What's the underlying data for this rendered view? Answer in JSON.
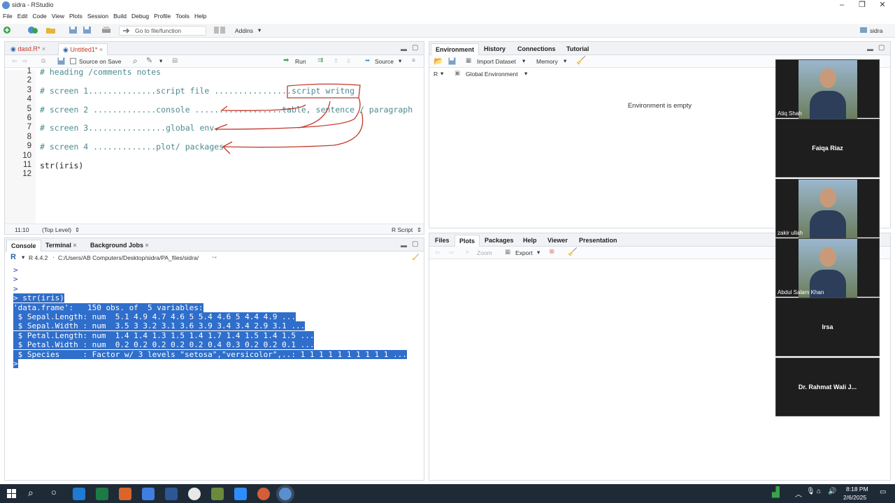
{
  "window": {
    "title": "sidra - RStudio",
    "user": "sidra"
  },
  "menu": [
    "File",
    "Edit",
    "Code",
    "View",
    "Plots",
    "Session",
    "Build",
    "Debug",
    "Profile",
    "Tools",
    "Help"
  ],
  "toolbar": {
    "goto_placeholder": "Go to file/function",
    "addins": "Addins"
  },
  "editor": {
    "tabs": [
      {
        "label": "dasd.R*"
      },
      {
        "label": "Untitled1*"
      }
    ],
    "source_on_save": "Source on Save",
    "run": "Run",
    "source": "Source",
    "lines": [
      {
        "n": "1",
        "text": "# heading /comments notes",
        "kind": "comment"
      },
      {
        "n": "2",
        "text": "",
        "kind": "plain"
      },
      {
        "n": "3",
        "text": "# screen 1..............script file ................script writng",
        "kind": "comment"
      },
      {
        "n": "4",
        "text": "",
        "kind": "plain"
      },
      {
        "n": "5",
        "text": "# screen 2 .............console ..................table, sentence / paragraph",
        "kind": "comment"
      },
      {
        "n": "6",
        "text": "",
        "kind": "plain"
      },
      {
        "n": "7",
        "text": "# screen 3................global env.",
        "kind": "comment"
      },
      {
        "n": "8",
        "text": "",
        "kind": "plain"
      },
      {
        "n": "9",
        "text": "# screen 4 .............plot/ packages",
        "kind": "comment"
      },
      {
        "n": "10",
        "text": "",
        "kind": "plain"
      },
      {
        "n": "11",
        "text": "str(iris)",
        "kind": "plain"
      },
      {
        "n": "12",
        "text": "",
        "kind": "plain"
      }
    ],
    "status_pos": "11:10",
    "status_scope": "(Top Level)",
    "status_type": "R Script"
  },
  "console": {
    "tabs": [
      "Console",
      "Terminal",
      "Background Jobs"
    ],
    "r_version": "R 4.4.2",
    "path": "C:/Users/AB Computers/Desktop/sidra/PA_files/sidra/",
    "lines": [
      {
        "text": ">",
        "selected": false
      },
      {
        "text": ">",
        "selected": false
      },
      {
        "text": ">",
        "selected": false
      },
      {
        "text": "> str(iris)",
        "selected": true
      },
      {
        "text": "'data.frame':   150 obs. of  5 variables:",
        "selected": true
      },
      {
        "text": " $ Sepal.Length: num  5.1 4.9 4.7 4.6 5 5.4 4.6 5 4.4 4.9 ...",
        "selected": true
      },
      {
        "text": " $ Sepal.Width : num  3.5 3 3.2 3.1 3.6 3.9 3.4 3.4 2.9 3.1 ...",
        "selected": true
      },
      {
        "text": " $ Petal.Length: num  1.4 1.4 1.3 1.5 1.4 1.7 1.4 1.5 1.4 1.5 ...",
        "selected": true
      },
      {
        "text": " $ Petal.Width : num  0.2 0.2 0.2 0.2 0.2 0.4 0.3 0.2 0.2 0.1 ...",
        "selected": true
      },
      {
        "text": " $ Species     : Factor w/ 3 levels \"setosa\",\"versicolor\",..: 1 1 1 1 1 1 1 1 1 1 ...",
        "selected": true
      },
      {
        "text": ">",
        "selected": true
      }
    ]
  },
  "env": {
    "tabs": [
      "Environment",
      "History",
      "Connections",
      "Tutorial"
    ],
    "import": "Import Dataset",
    "memory": "Memory",
    "lang": "R",
    "scope": "Global Environment",
    "empty": "Environment is empty"
  },
  "files": {
    "tabs": [
      "Files",
      "Plots",
      "Packages",
      "Help",
      "Viewer",
      "Presentation"
    ],
    "zoom": "Zoom",
    "export": "Export"
  },
  "participants": [
    {
      "name": "Atiq Shah",
      "video": true
    },
    {
      "name": "Faiqa Riaz",
      "video": false
    },
    {
      "name": "zakir ullah",
      "video": true
    },
    {
      "name": "Abdul Salam Khan",
      "video": true
    },
    {
      "name": "Irsa",
      "video": false
    },
    {
      "name": "Dr. Rahmat Wali J...",
      "video": false
    }
  ],
  "taskbar": {
    "time": "8:18 PM",
    "date": "2/6/2025"
  }
}
